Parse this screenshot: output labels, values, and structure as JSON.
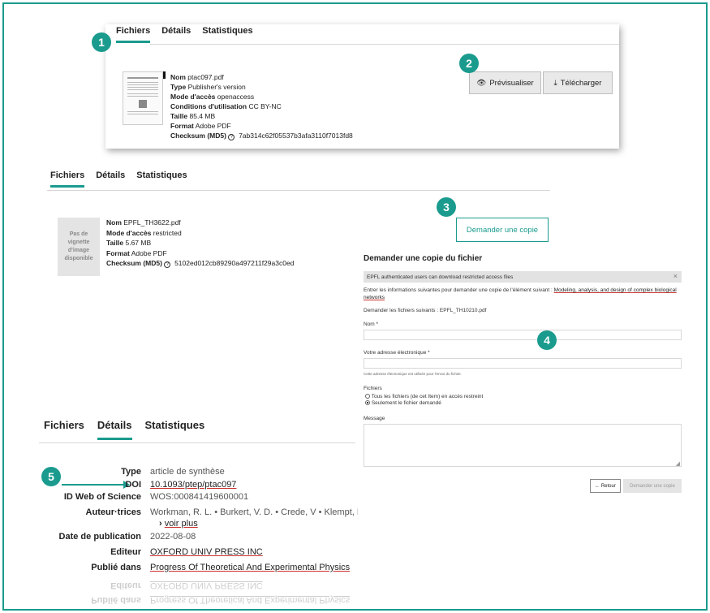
{
  "panel1": {
    "tabs": [
      "Fichiers",
      "Détails",
      "Statistiques"
    ],
    "file": {
      "nom_label": "Nom",
      "nom": "ptac097.pdf",
      "type_label": "Type",
      "type": "Publisher's version",
      "acces_label": "Mode d'accès",
      "acces": "openaccess",
      "cond_label": "Conditions d'utilisation",
      "cond": "CC BY-NC",
      "taille_label": "Taille",
      "taille": "85.4 MB",
      "format_label": "Format",
      "format": "Adobe PDF",
      "checksum_label": "Checksum (MD5)",
      "checksum": "7ab314c62f05537b3afa3110f7013fd8"
    },
    "preview_label": "Prévisualiser",
    "download_label": "Télécharger"
  },
  "panel2": {
    "tabs": [
      "Fichiers",
      "Détails",
      "Statistiques"
    ],
    "thumb_text": "Pas de vignette d'image disponible",
    "file": {
      "nom_label": "Nom",
      "nom": "EPFL_TH3622.pdf",
      "acces_label": "Mode d'accès",
      "acces": "restricted",
      "taille_label": "Taille",
      "taille": "5.67 MB",
      "format_label": "Format",
      "format": "Adobe PDF",
      "checksum_label": "Checksum (MD5)",
      "checksum": "5102ed012cb89290a497211f29a3c0ed"
    },
    "request_copy_label": "Demander une copie"
  },
  "request_form": {
    "title": "Demander une copie du fichier",
    "alert": "EPFL authenticated users can download restricted access files",
    "intro": "Entrer les informations suivantes pour demander une copie de l'élément suivant :",
    "intro_link": "Modeling, analysis, and design of complex biological networks",
    "files_line": "Demander les fichiers suivants : EPFL_TH10210.pdf",
    "name_label": "Nom *",
    "email_label": "Votre adresse électronique *",
    "email_help": "Cette adresse électronique est utilisée pour l'envoi du fichier.",
    "files_label": "Fichiers",
    "option_all": "Tous les fichiers (de cet Item) en accès restreint",
    "option_one": "Seulement le fichier demandé",
    "message_label": "Message",
    "back_label": "← Retour",
    "submit_label": "Demander une copie"
  },
  "panel3": {
    "tabs": [
      "Fichiers",
      "Détails",
      "Statistiques"
    ],
    "rows": [
      {
        "label": "Type",
        "value": "article de synthèse"
      },
      {
        "label": "DOI",
        "value": "10.1093/ptep/ptac097"
      },
      {
        "label": "ID Web of Science",
        "value": "WOS:000841419600001"
      },
      {
        "label": "Auteur·trices",
        "value": "Workman, R. L. • Burkert, V. D. • Crede, V • Klempt, E"
      },
      {
        "label": "",
        "value": "voir plus"
      },
      {
        "label": "Date de publication",
        "value": "2022-08-08"
      },
      {
        "label": "Editeur",
        "value": "OXFORD UNIV PRESS INC"
      },
      {
        "label": "Publié dans",
        "value": "Progress Of Theoretical And Experimental Physics"
      }
    ]
  },
  "badges": [
    "1",
    "2",
    "3",
    "4",
    "5"
  ],
  "colors": {
    "accent": "#1a9b8e",
    "link_underline": "#c9302c"
  }
}
